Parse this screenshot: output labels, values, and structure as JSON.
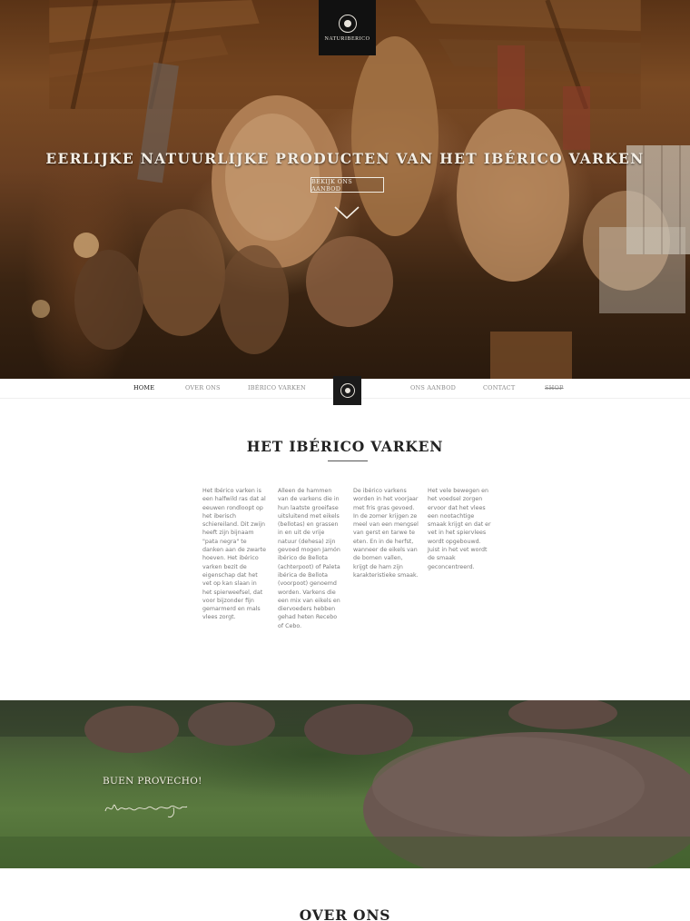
{
  "brand": {
    "logo_text": "NATURIBERICO"
  },
  "hero": {
    "title": "EERLIJKE NATUURLIJKE PRODUCTEN VAN HET IBÉRICO VARKEN",
    "button_label": "BEKIJK ONS AANBOD",
    "scroll_icon": "chevron-down-icon"
  },
  "nav": {
    "items": [
      {
        "label": "HOME",
        "active": true
      },
      {
        "label": "OVER ONS"
      },
      {
        "label": "IBÉRICO VARKEN"
      },
      {
        "label": "ONS AANBOD"
      },
      {
        "label": "CONTACT"
      },
      {
        "label": "SHOP"
      }
    ]
  },
  "intro": {
    "title": "HET IBÉRICO VARKEN",
    "columns": [
      "Het Ibérico varken is een halfwild ras dat al eeuwen rondloopt op het iberisch schiereiland. Dit zwijn heeft zijn bijnaam \"pata negra\" te danken aan de zwarte hoeven. Het ibérico varken bezit de eigenschap dat het vet op kan slaan in het spierweefsel, dat voor bijzonder fijn gemarmerd en mals vlees zorgt.",
      "Alleen de hammen van de varkens die in hun laatste groeifase uitsluitend met eikels (bellotas) en grassen in en uit de vrije natuur (dehesa) zijn gevoed mogen Jamón ibérico de Bellota (achterpoot) of Paleta ibérica de Bellota (voorpoot) genoemd worden. Varkens die een mix van eikels en diervoeders hebben gehad heten Recebo of Cebo.",
      "De ibérico varkens worden in het voorjaar met fris gras gevoed. In de zomer krijgen ze meel van een mengsel van gerst en tarwe te eten. En in de herfst, wanneer de eikels van de bomen vallen, krijgt de ham zijn karakteristieke smaak.",
      "Het vele bewegen en het voedsel zorgen ervoor dat het vlees een nootachtige smaak krijgt en dat er vet in het spiervlees wordt opgebouwd. Juist in het vet wordt de smaak geconcentreerd."
    ]
  },
  "banner": {
    "greeting": "BUEN PROVECHO!",
    "signature": "Miranda Hovingh"
  },
  "about": {
    "title": "OVER ONS"
  },
  "colors": {
    "nav_active": "#111111",
    "nav_inactive": "#8a8a8a",
    "logo_bg": "#111111",
    "hero_text": "#f4efe6"
  }
}
